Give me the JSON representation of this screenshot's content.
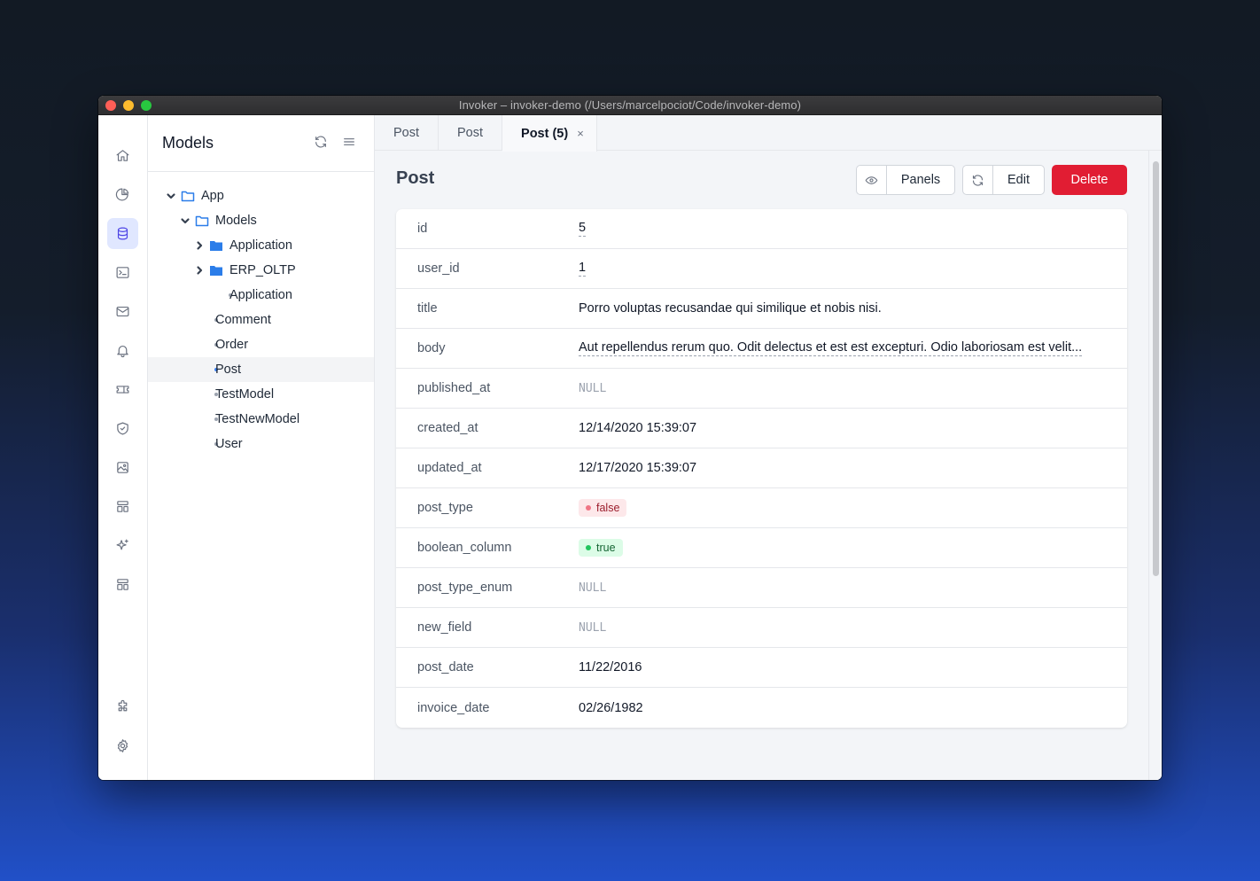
{
  "window": {
    "title": "Invoker – invoker-demo (/Users/marcelpociot/Code/invoker-demo)"
  },
  "rail": {
    "items": [
      {
        "name": "home-icon",
        "active": false
      },
      {
        "name": "pie-chart-icon",
        "active": false
      },
      {
        "name": "database-icon",
        "active": true
      },
      {
        "name": "terminal-icon",
        "active": false
      },
      {
        "name": "mail-icon",
        "active": false
      },
      {
        "name": "bell-icon",
        "active": false
      },
      {
        "name": "ticket-icon",
        "active": false
      },
      {
        "name": "shield-check-icon",
        "active": false
      },
      {
        "name": "image-icon",
        "active": false
      },
      {
        "name": "template-icon",
        "active": false
      },
      {
        "name": "sparkles-icon",
        "active": false
      },
      {
        "name": "template-icon",
        "active": false
      }
    ],
    "bottom": [
      {
        "name": "puzzle-icon"
      },
      {
        "name": "gear-icon"
      }
    ]
  },
  "tree": {
    "title": "Models",
    "items": [
      {
        "label": "App",
        "type": "folder-open",
        "depth": 0
      },
      {
        "label": "Models",
        "type": "folder-open",
        "depth": 1
      },
      {
        "label": "Application",
        "type": "folder-closed",
        "depth": 2
      },
      {
        "label": "ERP_OLTP",
        "type": "folder-closed",
        "depth": 2
      },
      {
        "label": "Application",
        "type": "leaf",
        "depth": 2
      },
      {
        "label": "Comment",
        "type": "leaf",
        "depth": 1
      },
      {
        "label": "Order",
        "type": "leaf",
        "depth": 1
      },
      {
        "label": "Post",
        "type": "leaf",
        "depth": 1,
        "selected": true
      },
      {
        "label": "TestModel",
        "type": "leaf",
        "depth": 1
      },
      {
        "label": "TestNewModel",
        "type": "leaf",
        "depth": 1
      },
      {
        "label": "User",
        "type": "leaf",
        "depth": 1
      }
    ]
  },
  "tabs": [
    {
      "label": "Post",
      "active": false
    },
    {
      "label": "Post",
      "active": false
    },
    {
      "label": "Post (5)",
      "active": true,
      "close": "×"
    }
  ],
  "detail": {
    "title": "Post",
    "panels_label": "Panels",
    "edit_label": "Edit",
    "delete_label": "Delete",
    "fields": [
      {
        "name": "id",
        "value": "5",
        "kind": "link"
      },
      {
        "name": "user_id",
        "value": "1",
        "kind": "link"
      },
      {
        "name": "title",
        "value": "Porro voluptas recusandae qui similique et nobis nisi.",
        "kind": "text"
      },
      {
        "name": "body",
        "value": "Aut repellendus rerum quo. Odit delectus et est est excepturi. Odio laboriosam est velit...",
        "kind": "link"
      },
      {
        "name": "published_at",
        "value": "NULL",
        "kind": "null"
      },
      {
        "name": "created_at",
        "value": "12/14/2020 15:39:07",
        "kind": "text"
      },
      {
        "name": "updated_at",
        "value": "12/17/2020 15:39:07",
        "kind": "text"
      },
      {
        "name": "post_type",
        "value": "false",
        "kind": "badge-false"
      },
      {
        "name": "boolean_column",
        "value": "true",
        "kind": "badge-true"
      },
      {
        "name": "post_type_enum",
        "value": "NULL",
        "kind": "null"
      },
      {
        "name": "new_field",
        "value": "NULL",
        "kind": "null"
      },
      {
        "name": "post_date",
        "value": "11/22/2016",
        "kind": "text"
      },
      {
        "name": "invoice_date",
        "value": "02/26/1982",
        "kind": "text"
      }
    ]
  },
  "colors": {
    "accent": "#4f46e5",
    "danger": "#e11d33",
    "folder": "#2b7de9"
  }
}
